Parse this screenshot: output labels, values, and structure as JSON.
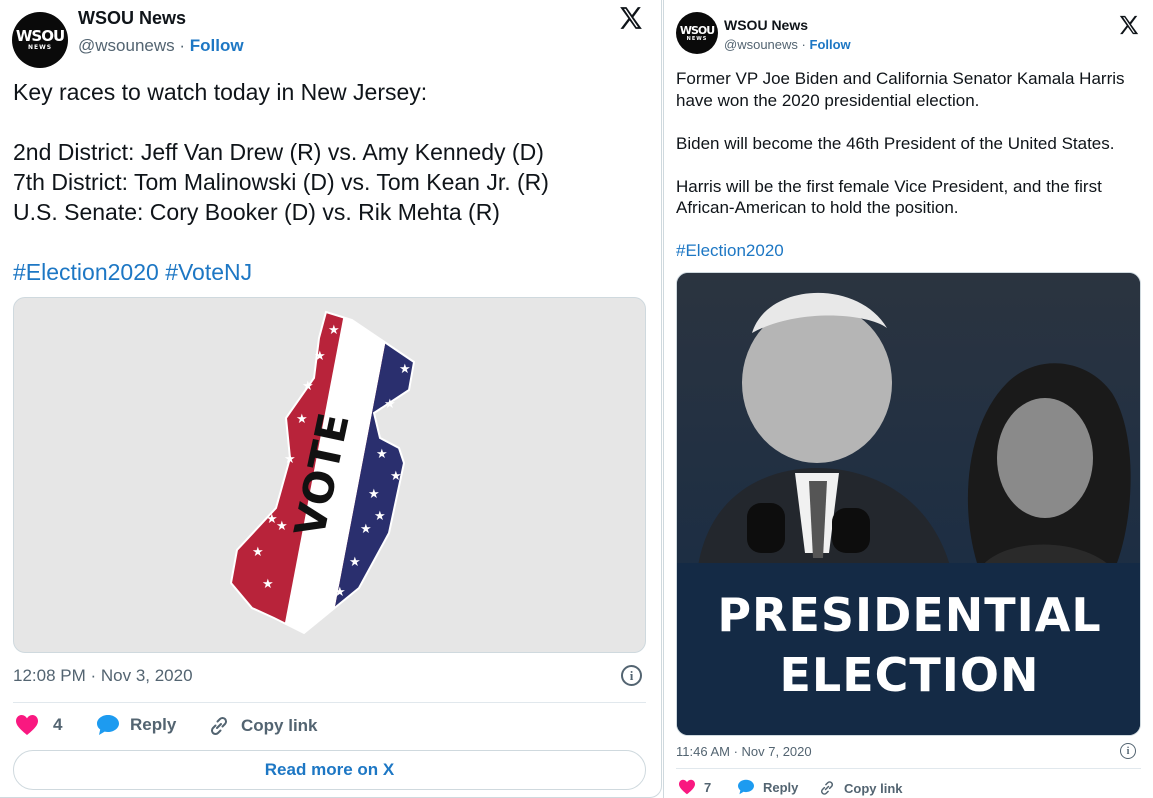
{
  "tweet1": {
    "avatar": {
      "line1": "WSOU",
      "line2": "NEWS"
    },
    "name": "WSOU News",
    "handle": "@wsounews",
    "separator": "·",
    "follow": "Follow",
    "lines": [
      "Key races to watch today in New Jersey:",
      "2nd District: Jeff Van Drew (R) vs. Amy Kennedy (D)",
      "7th District: Tom Malinowski (D) vs. Tom Kean Jr. (R)",
      "U.S. Senate: Cory Booker (D) vs. Rik Mehta (R)"
    ],
    "hashtags": [
      "#Election2020",
      "#VoteNJ"
    ],
    "image": {
      "text": "VOTE",
      "colors": {
        "red": "#b8233a",
        "blue": "#2a2f6e",
        "white": "#ffffff",
        "bg": "#e6e6e6"
      }
    },
    "timestamp": "12:08 PM · Nov 3, 2020",
    "likes": "4",
    "reply": "Reply",
    "copy_link": "Copy link",
    "read_more": "Read more on X"
  },
  "tweet2": {
    "avatar": {
      "line1": "WSOU",
      "line2": "NEWS"
    },
    "name": "WSOU News",
    "handle": "@wsounews",
    "separator": "·",
    "follow": "Follow",
    "paragraphs": [
      [
        "Former VP Joe Biden and California Senator Kamala Harris",
        "have won the 2020 presidential election."
      ],
      [
        "Biden will become the 46th President of the United States."
      ],
      [
        "Harris will be the first female Vice President, and the first",
        "African-American to hold the position."
      ]
    ],
    "hashtag": "#Election2020",
    "image": {
      "line1": "PRESIDENTIAL",
      "line2": "ELECTION",
      "bg": "#142a45"
    },
    "timestamp": "11:46 AM · Nov 7, 2020",
    "likes": "7",
    "reply": "Reply",
    "copy_link": "Copy link"
  },
  "colors": {
    "link": "#1d77c4",
    "heart": "#f91880",
    "secondary": "#536471"
  }
}
